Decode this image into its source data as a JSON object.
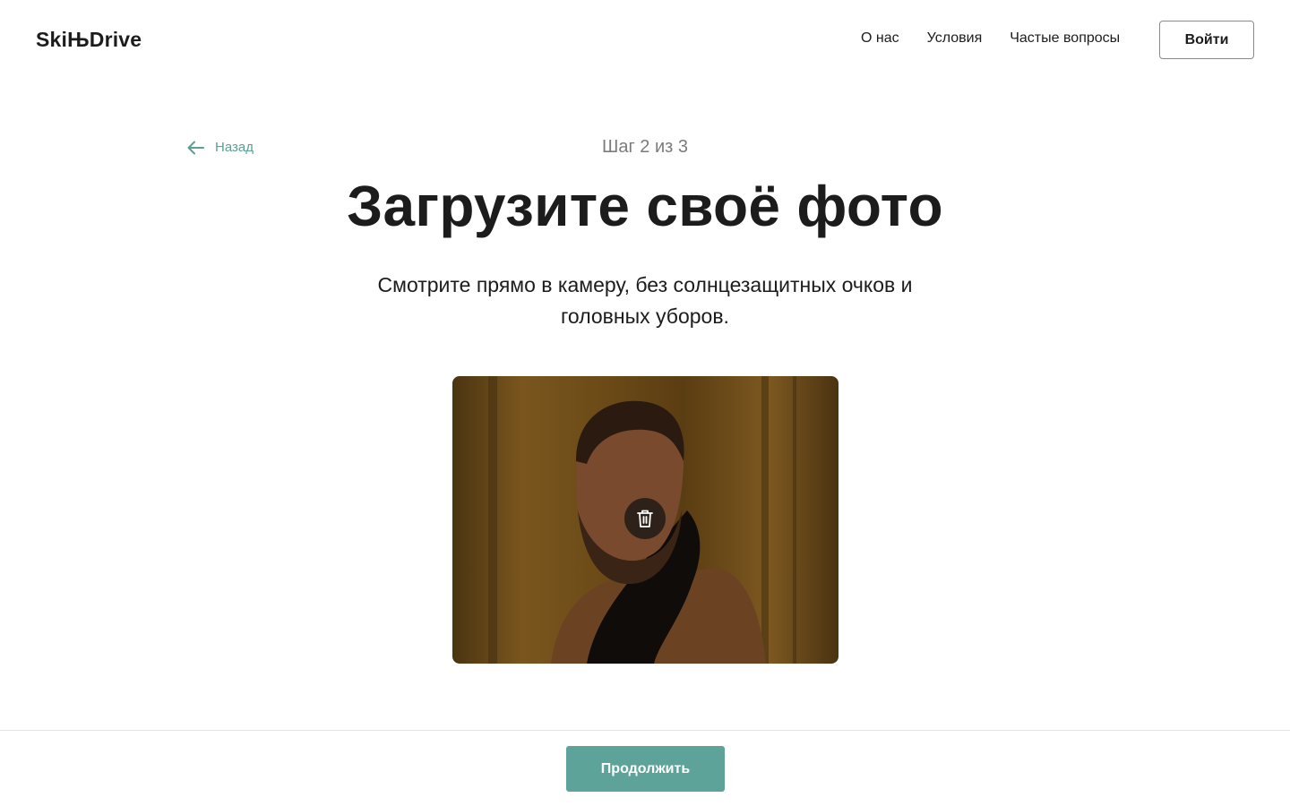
{
  "header": {
    "logo": "SkiЊDrive",
    "nav": [
      "О нас",
      "Условия",
      "Частые вопросы"
    ],
    "login_label": "Войти"
  },
  "main": {
    "back_label": "Назад",
    "step": "Шаг 2 из 3",
    "title": "Загрузите своё фото",
    "subtitle": "Смотрите прямо в камеру, без солнцезащитных очков и головных уборов.",
    "photo_icon": "uploaded-photo",
    "delete_icon": "trash-icon"
  },
  "footer": {
    "continue_label": "Продолжить"
  },
  "colors": {
    "accent": "#5ea399",
    "text": "#1c1c1c",
    "muted": "#7b7b7b"
  }
}
